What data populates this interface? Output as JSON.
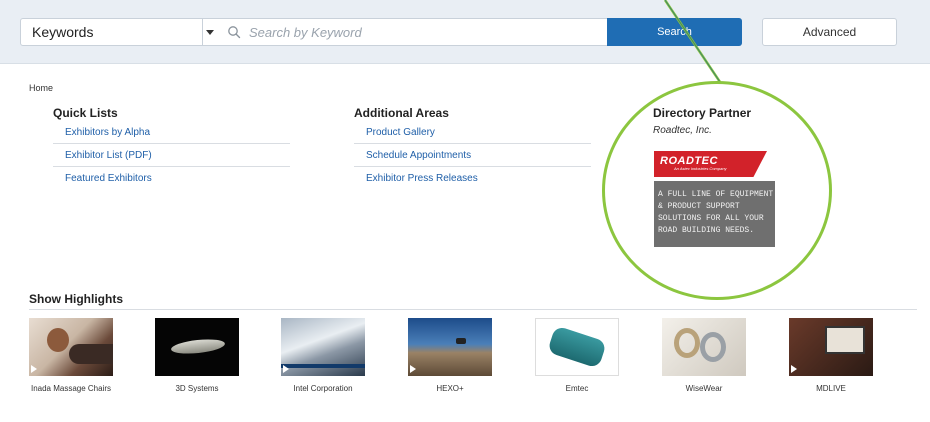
{
  "search": {
    "category_selected": "Keywords",
    "placeholder": "Search by Keyword",
    "search_button": "Search",
    "advanced_button": "Advanced"
  },
  "breadcrumb": "Home",
  "quick_lists": {
    "title": "Quick Lists",
    "links": [
      "Exhibitors by Alpha",
      "Exhibitor List (PDF)",
      "Featured Exhibitors"
    ]
  },
  "additional_areas": {
    "title": "Additional Areas",
    "links": [
      "Product Gallery",
      "Schedule Appointments",
      "Exhibitor Press Releases"
    ]
  },
  "directory_partner": {
    "title": "Directory Partner",
    "name": "Roadtec, Inc.",
    "ad_logo": "ROADTEC",
    "ad_logo_sub": "An Astec Industries Company",
    "ad_text": "A FULL LINE OF EQUIPMENT & PRODUCT SUPPORT SOLUTIONS FOR ALL YOUR ROAD BUILDING NEEDS."
  },
  "show_highlights": {
    "title": "Show Highlights",
    "items": [
      {
        "label": "Inada Massage Chairs",
        "icon": "massage-chair-photo"
      },
      {
        "label": "3D Systems",
        "icon": "3d-print-photo"
      },
      {
        "label": "Intel Corporation",
        "icon": "snowboard-photo"
      },
      {
        "label": "HEXO+",
        "icon": "drone-photo"
      },
      {
        "label": "Emtec",
        "icon": "device-photo"
      },
      {
        "label": "WiseWear",
        "icon": "bracelet-photo"
      },
      {
        "label": "MDLIVE",
        "icon": "laptop-photo"
      }
    ]
  },
  "colors": {
    "accent_blue": "#1f6db4",
    "link_blue": "#1f5fa8",
    "highlight_green": "#8cc63f",
    "brand_red": "#d2222a"
  }
}
